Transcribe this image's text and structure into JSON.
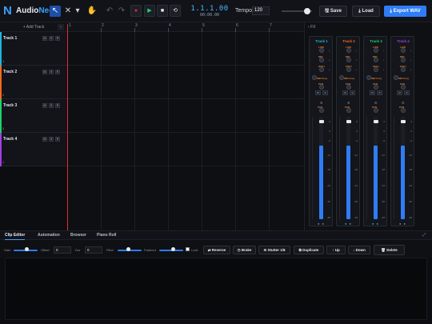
{
  "app": {
    "logo_glyph": "N",
    "name_a": "Audio",
    "name_b": "Neo"
  },
  "toolbar": {
    "tools": [
      {
        "icon": "pointer-icon",
        "glyph": "↖",
        "selected": true
      },
      {
        "icon": "scissors-icon",
        "glyph": "✕",
        "selected": false
      },
      {
        "icon": "chevron-down-icon",
        "glyph": "▾",
        "selected": false
      },
      {
        "icon": "hand-icon",
        "glyph": "✋",
        "selected": false
      }
    ],
    "undo_glyph": "↶",
    "redo_glyph": "↷",
    "record_glyph": "●",
    "play_glyph": "▶",
    "stop_glyph": "■",
    "loop_glyph": "⟲",
    "timecode": "1.1.1.00",
    "clock": "00:00.00",
    "tempo_label": "Tempo",
    "tempo_value": "120",
    "master_volume": 0.85,
    "save_label": "Save",
    "load_label": "Load",
    "export_label": "Export WAV",
    "save_glyph": "🖫",
    "load_glyph": "⤓",
    "export_glyph": "⤓"
  },
  "arrange": {
    "add_track_label": "+ Add Track",
    "scroll_left_glyph": "‹",
    "ruler": [
      "1",
      "2",
      "3",
      "4",
      "5",
      "6",
      "7"
    ]
  },
  "tracks": [
    {
      "name": "Track 1",
      "index": "1",
      "color": "#1eb6e0",
      "m": "M",
      "s": "S",
      "r": "R"
    },
    {
      "name": "Track 2",
      "index": "2",
      "color": "#f26a1b",
      "m": "M",
      "s": "S",
      "r": "R"
    },
    {
      "name": "Track 3",
      "index": "3",
      "color": "#1ed36a",
      "m": "M",
      "s": "S",
      "r": "R"
    },
    {
      "name": "Track 4",
      "index": "4",
      "color": "#a23fe6",
      "m": "M",
      "s": "S",
      "r": "R"
    }
  ],
  "mixer": {
    "title": "FX",
    "collapse_glyph": "‹",
    "eq_labels": [
      "LOW",
      "MID",
      "HIGH"
    ],
    "mid_freq_label": "MID Freq",
    "pan_label": "PAN",
    "m": "M",
    "s": "S",
    "fx_glyph": "⚙",
    "db_scale": [
      "6",
      "0",
      "-6",
      "-12",
      "-18",
      "-24",
      "-36",
      "-48"
    ],
    "led_glyph": "● ●",
    "strips": [
      {
        "name": "Track 1",
        "color": "#1eb6e0",
        "level": 0.72
      },
      {
        "name": "Track 2",
        "color": "#f26a1b",
        "level": 0.72
      },
      {
        "name": "Track 3",
        "color": "#1ed36a",
        "level": 0.72
      },
      {
        "name": "Track 4",
        "color": "#a23fe6",
        "level": 0.72
      }
    ]
  },
  "bottom": {
    "tabs": [
      "Clip Editor",
      "Automation",
      "Browser",
      "Piano Roll"
    ],
    "active_tab": "Clip Editor",
    "corner_glyph": "⤢",
    "gain_label": "Gain",
    "offset_label": "Offset",
    "offset_value": "0",
    "dur_label": "Dur",
    "dur_value": "0",
    "pitch_label": "Pitch",
    "fadeout_label": "Fadeout",
    "lock_label": "Lock",
    "actions": [
      {
        "label": "Reverse",
        "glyph": "⇄"
      },
      {
        "label": "Brake",
        "glyph": "◷"
      },
      {
        "label": "Stutter 1/8",
        "glyph": "≋"
      },
      {
        "label": "Duplicate",
        "glyph": "⧉"
      },
      {
        "label": "Up",
        "glyph": "↑"
      },
      {
        "label": "Down",
        "glyph": "↓"
      },
      {
        "label": "Delete",
        "glyph": "🗑"
      }
    ]
  },
  "colors": {
    "accent": "#2f7cf6",
    "playhead": "#e0293a",
    "eq_label": "#e07a2e"
  }
}
